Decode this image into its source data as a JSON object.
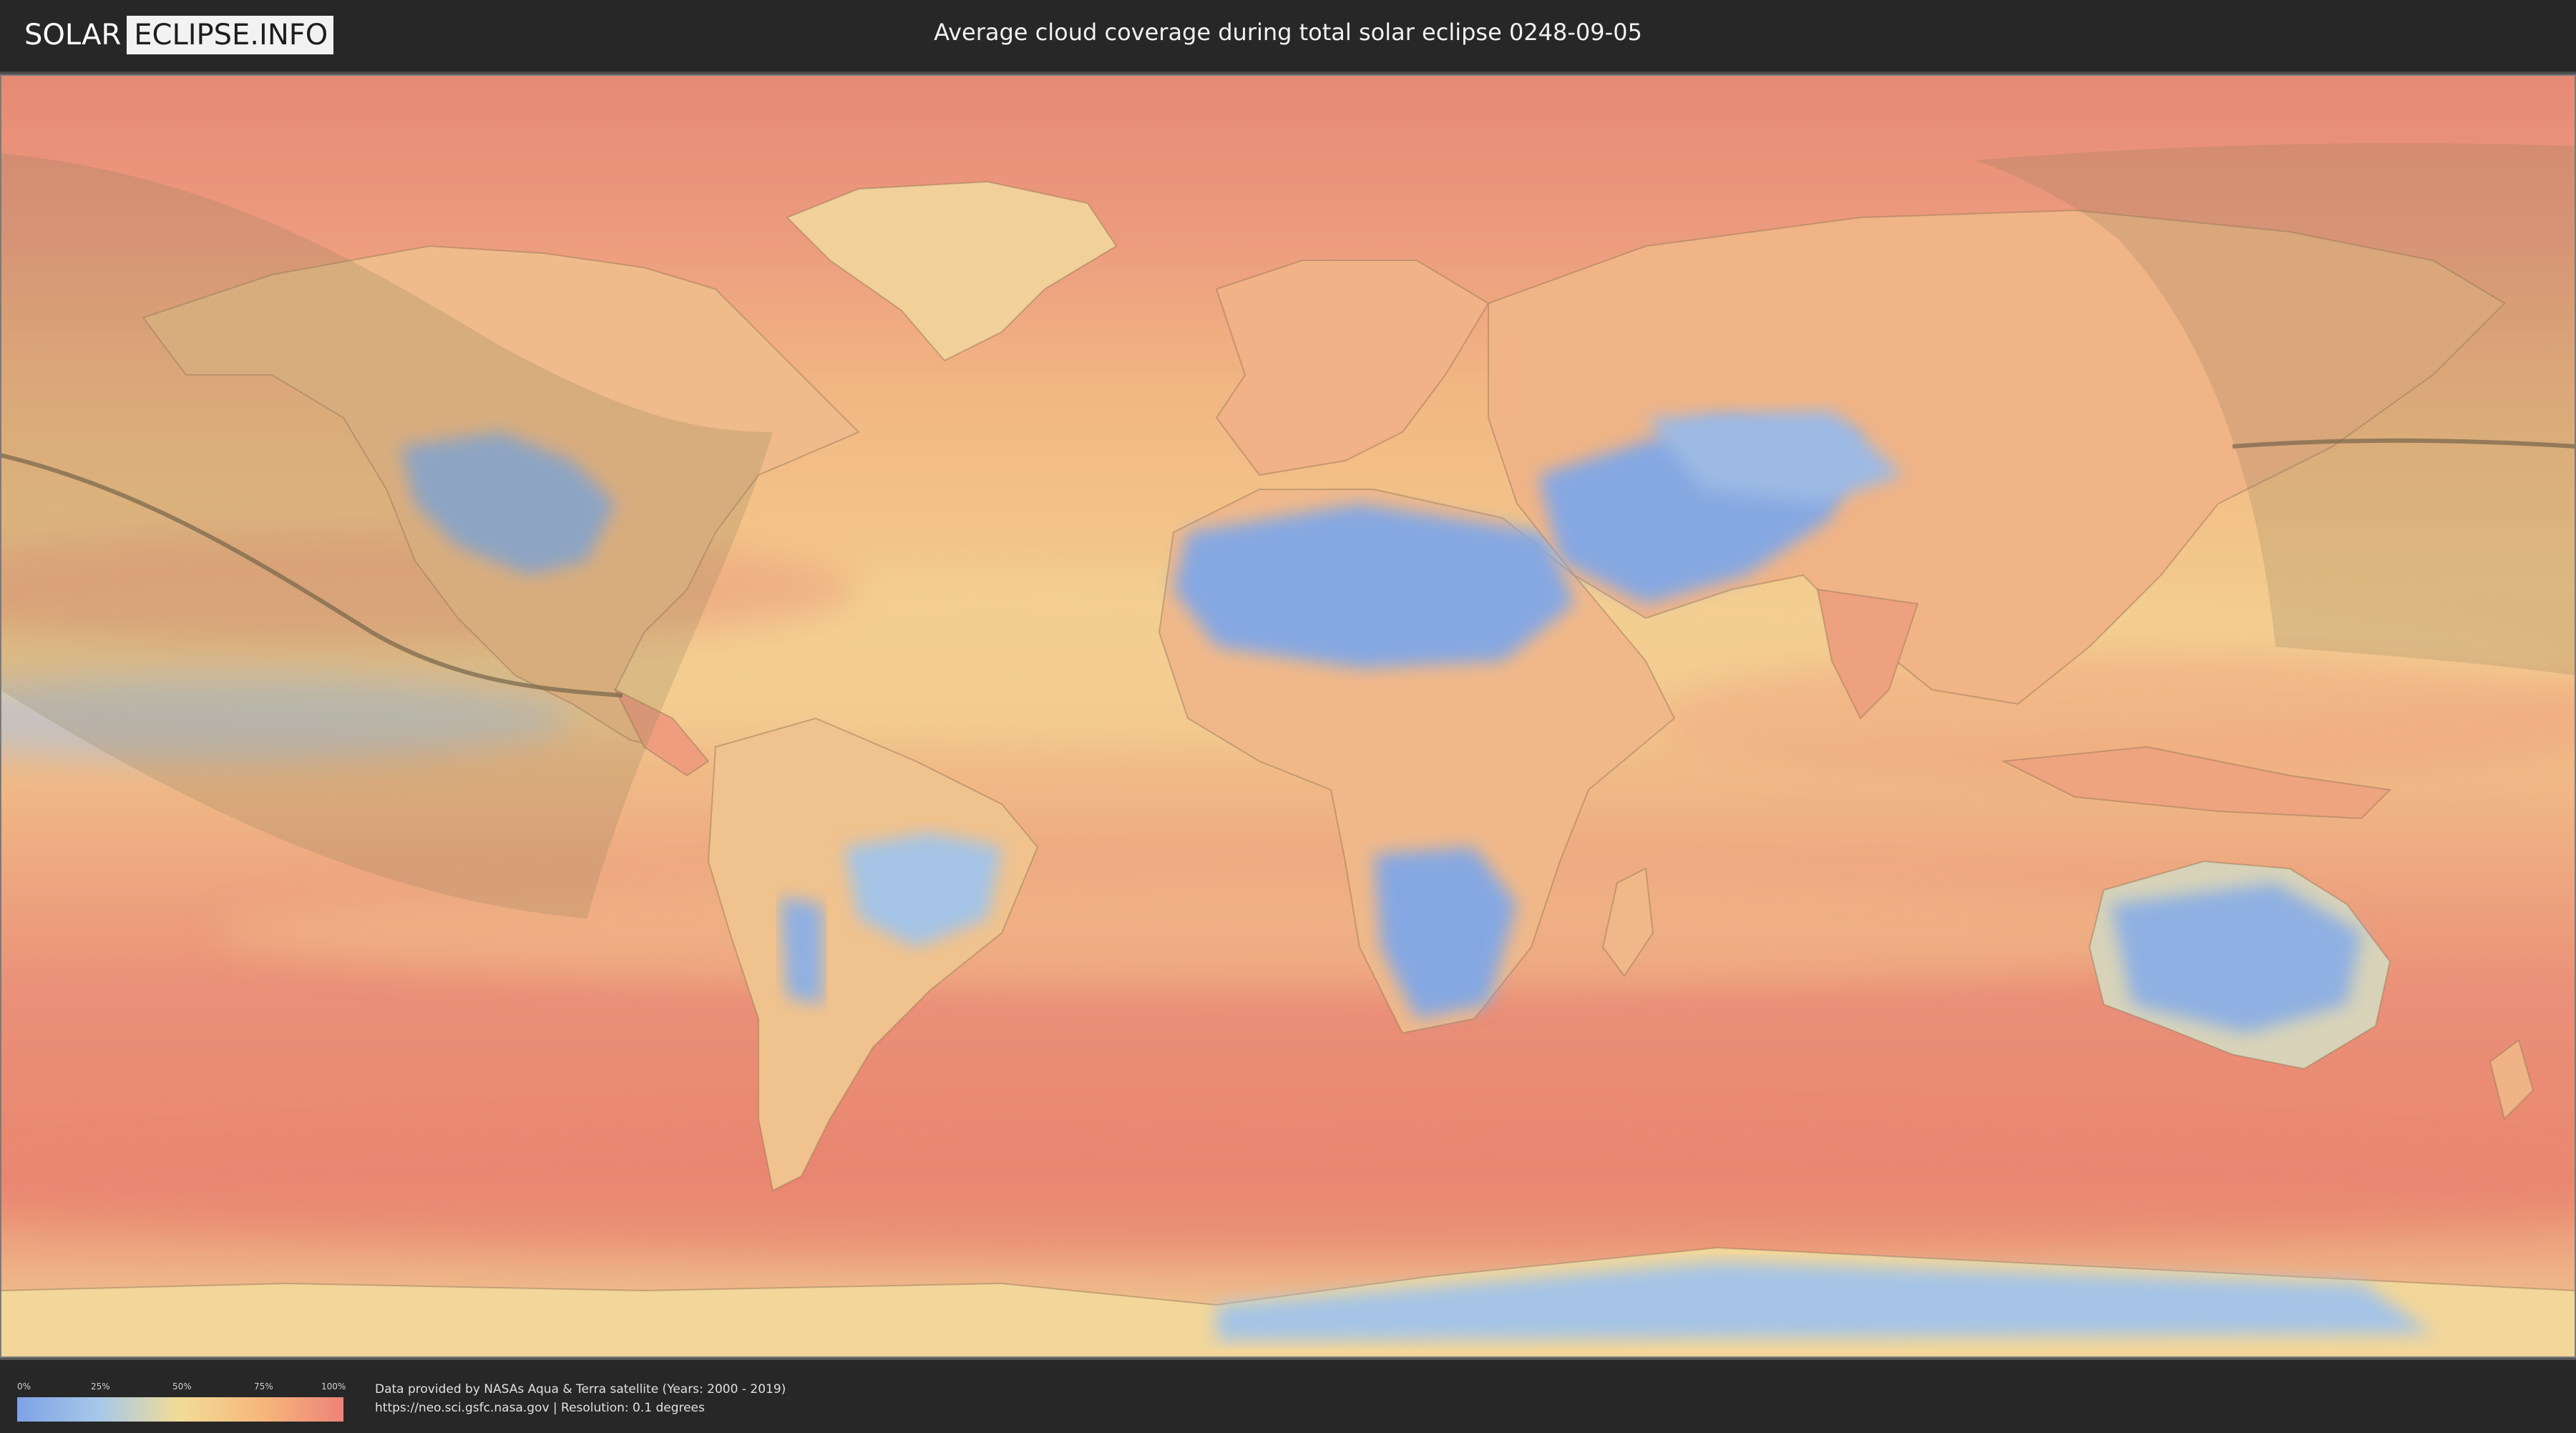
{
  "header": {
    "logo_part1": "SOLAR",
    "logo_part2": "ECLIPSE.INFO",
    "title": "Average cloud coverage during total solar eclipse 0248-09-05"
  },
  "map": {
    "type": "world-map-equirectangular",
    "layer": "average cloud coverage",
    "overlays": [
      "eclipse-visibility-zone",
      "totality-path"
    ]
  },
  "legend": {
    "ticks": [
      "0%",
      "25%",
      "50%",
      "75%",
      "100%"
    ],
    "colors": [
      "#7fa2e6",
      "#a6c8e8",
      "#f2dc96",
      "#f6b77b",
      "#ee8277"
    ]
  },
  "credits": {
    "line1": "Data provided by NASAs Aqua & Terra satellite (Years: 2000 - 2019)",
    "line2": "https://neo.sci.gsfc.nasa.gov | Resolution: 0.1 degrees"
  }
}
